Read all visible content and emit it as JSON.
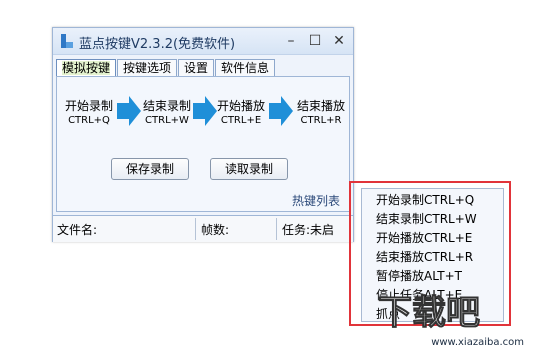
{
  "window": {
    "title": "蓝点按键V2.3.2(免费软件)",
    "controls": {
      "minimize": "–",
      "maximize": "☐",
      "close": "✕"
    }
  },
  "tabs": [
    {
      "label": "模拟按键",
      "active": true
    },
    {
      "label": "按键选项",
      "active": false
    },
    {
      "label": "设置",
      "active": false
    },
    {
      "label": "软件信息",
      "active": false
    }
  ],
  "steps": [
    {
      "label": "开始录制",
      "key": "CTRL+Q"
    },
    {
      "label": "结束录制",
      "key": "CTRL+W"
    },
    {
      "label": "开始播放",
      "key": "CTRL+E"
    },
    {
      "label": "结束播放",
      "key": "CTRL+R"
    }
  ],
  "buttons": {
    "save": "保存录制",
    "load": "读取录制"
  },
  "hotkey_list_label": "热键列表",
  "status": {
    "filename": "文件名:",
    "frames": "帧数:",
    "task": "任务:未启"
  },
  "menu_items": [
    "开始录制CTRL+Q",
    "结束录制CTRL+W",
    "开始播放CTRL+E",
    "结束播放CTRL+R",
    "暂停播放ALT+T",
    "停止任务ALT+E",
    "抓点"
  ],
  "watermark": {
    "logo": "下载吧",
    "url": "www.xiazaiba.com"
  },
  "colors": {
    "arrow": "#1f8fd8",
    "highlight": "#e1343a",
    "accent": "#1f3b63"
  }
}
